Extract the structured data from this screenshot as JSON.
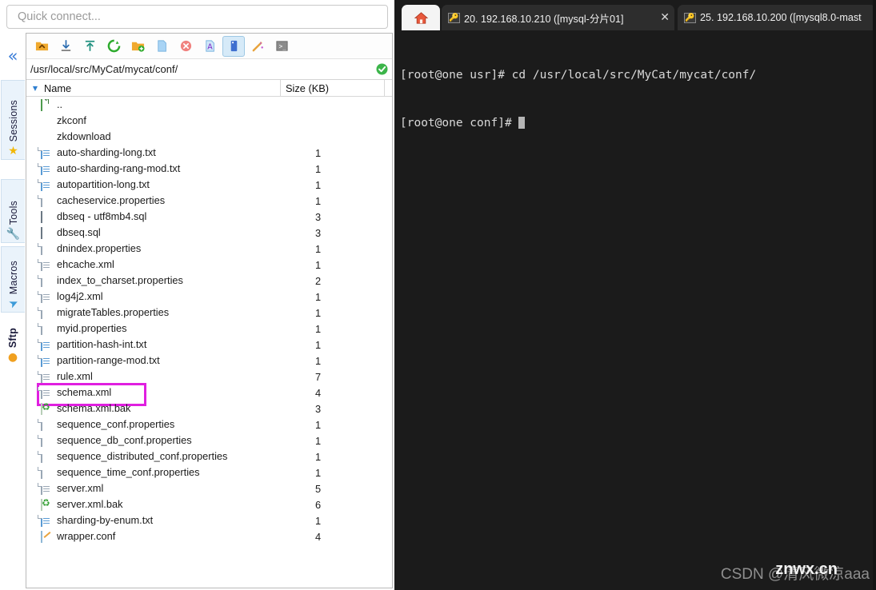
{
  "quick_connect": {
    "placeholder": "Quick connect..."
  },
  "sidebar": {
    "collapse_label": "«",
    "tabs": [
      {
        "label": "Sessions",
        "icon": "star-icon",
        "glyph": "★"
      },
      {
        "label": "Tools",
        "icon": "tools-icon",
        "glyph": "🔧"
      },
      {
        "label": "Macros",
        "icon": "macros-icon",
        "glyph": "➤"
      },
      {
        "label": "Sftp",
        "icon": "sftp-icon",
        "glyph": "●"
      }
    ]
  },
  "toolbar": {
    "buttons": [
      {
        "name": "parent-folder-icon",
        "glyph": "⬆",
        "active": false
      },
      {
        "name": "download-icon",
        "glyph": "⤓",
        "active": false
      },
      {
        "name": "upload-icon",
        "glyph": "⤒",
        "active": false
      },
      {
        "name": "refresh-icon",
        "glyph": "⟳",
        "active": false
      },
      {
        "name": "new-folder-icon",
        "glyph": "🗀",
        "active": false
      },
      {
        "name": "new-file-icon",
        "glyph": "🗋",
        "active": false
      },
      {
        "name": "delete-icon",
        "glyph": "✕",
        "active": false
      },
      {
        "name": "edit-text-icon",
        "glyph": "A",
        "active": false
      },
      {
        "name": "binary-edit-icon",
        "glyph": "▮",
        "active": true
      },
      {
        "name": "magic-wand-icon",
        "glyph": "✨",
        "active": false
      },
      {
        "name": "open-terminal-icon",
        "glyph": "▮",
        "active": false
      }
    ]
  },
  "path_bar": {
    "path": "/usr/local/src/MyCat/mycat/conf/",
    "status_icon": "check-circle-icon"
  },
  "list_header": {
    "sort_arrow": "▼",
    "name": "Name",
    "size": "Size (KB)"
  },
  "files": [
    {
      "name": "..",
      "size": "",
      "icon": "folder-up",
      "highlight": false
    },
    {
      "name": "zkconf",
      "size": "",
      "icon": "folder",
      "highlight": false
    },
    {
      "name": "zkdownload",
      "size": "",
      "icon": "folder",
      "highlight": false
    },
    {
      "name": "auto-sharding-long.txt",
      "size": "1",
      "icon": "doc-blue",
      "highlight": false
    },
    {
      "name": "auto-sharding-rang-mod.txt",
      "size": "1",
      "icon": "doc-blue",
      "highlight": false
    },
    {
      "name": "autopartition-long.txt",
      "size": "1",
      "icon": "doc-blue",
      "highlight": false
    },
    {
      "name": "cacheservice.properties",
      "size": "1",
      "icon": "doc-plain",
      "highlight": false
    },
    {
      "name": "dbseq - utf8mb4.sql",
      "size": "3",
      "icon": "sql",
      "highlight": false
    },
    {
      "name": "dbseq.sql",
      "size": "3",
      "icon": "sql",
      "highlight": false
    },
    {
      "name": "dnindex.properties",
      "size": "1",
      "icon": "doc-plain",
      "highlight": false
    },
    {
      "name": "ehcache.xml",
      "size": "1",
      "icon": "doc-gray",
      "highlight": false
    },
    {
      "name": "index_to_charset.properties",
      "size": "2",
      "icon": "doc-plain",
      "highlight": false
    },
    {
      "name": "log4j2.xml",
      "size": "1",
      "icon": "doc-gray",
      "highlight": false
    },
    {
      "name": "migrateTables.properties",
      "size": "1",
      "icon": "doc-plain",
      "highlight": false
    },
    {
      "name": "myid.properties",
      "size": "1",
      "icon": "doc-plain",
      "highlight": false
    },
    {
      "name": "partition-hash-int.txt",
      "size": "1",
      "icon": "doc-blue",
      "highlight": false
    },
    {
      "name": "partition-range-mod.txt",
      "size": "1",
      "icon": "doc-blue",
      "highlight": false
    },
    {
      "name": "rule.xml",
      "size": "7",
      "icon": "doc-gray",
      "highlight": false
    },
    {
      "name": "schema.xml",
      "size": "4",
      "icon": "doc-gray",
      "highlight": true
    },
    {
      "name": "schema.xml.bak",
      "size": "3",
      "icon": "bak",
      "highlight": false
    },
    {
      "name": "sequence_conf.properties",
      "size": "1",
      "icon": "doc-plain",
      "highlight": false
    },
    {
      "name": "sequence_db_conf.properties",
      "size": "1",
      "icon": "doc-plain",
      "highlight": false
    },
    {
      "name": "sequence_distributed_conf.properties",
      "size": "1",
      "icon": "doc-plain",
      "highlight": false
    },
    {
      "name": "sequence_time_conf.properties",
      "size": "1",
      "icon": "doc-plain",
      "highlight": false
    },
    {
      "name": "server.xml",
      "size": "5",
      "icon": "doc-gray",
      "highlight": false
    },
    {
      "name": "server.xml.bak",
      "size": "6",
      "icon": "bak",
      "highlight": false
    },
    {
      "name": "sharding-by-enum.txt",
      "size": "1",
      "icon": "doc-blue",
      "highlight": false
    },
    {
      "name": "wrapper.conf",
      "size": "4",
      "icon": "conf",
      "highlight": false
    }
  ],
  "terminal_tabs": {
    "home_icon": "home-icon",
    "tabs": [
      {
        "title": "20.  192.168.10.210  ([mysql-分片01]",
        "close": "✕",
        "icon": "key-icon"
      },
      {
        "title": "25. 192.168.10.200 ([mysql8.0-mast",
        "close": "",
        "icon": "key-icon"
      }
    ]
  },
  "terminal": {
    "lines": [
      "[root@one usr]# cd /usr/local/src/MyCat/mycat/conf/",
      "[root@one conf]# "
    ]
  },
  "watermark": {
    "text": "CSDN @清风微凉aaa",
    "overlay": "znwx.cn"
  },
  "colors": {
    "accent": "#3b7dd8",
    "highlight_box": "#e01fe0",
    "terminal_bg": "#1b1b1b",
    "folder": "#f5b433"
  }
}
